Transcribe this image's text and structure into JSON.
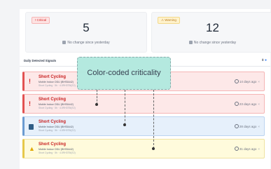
{
  "stats": [
    {
      "badge": "! Critical",
      "value": "5",
      "note": "No change since yesterday",
      "kind": "crit"
    },
    {
      "badge": "⚠ Warning",
      "value": "12",
      "note": "No change since yesterday",
      "kind": "warn"
    }
  ],
  "section": {
    "title": "Daily Detected Signals",
    "filter_icon": "filter-icon",
    "info_icon": "info-icon"
  },
  "signals": [
    {
      "severity": "critical",
      "icon": "alert-exclamation-icon",
      "title": "Short Cycling",
      "subtitle": "Mobile Indoor ODU (BHS5A42)",
      "meta": "Short Cycling · 5h · 4.0RH3T5I(E2)",
      "age": "14 days ago"
    },
    {
      "severity": "critical",
      "icon": "alert-exclamation-icon",
      "title": "Short Cycling",
      "subtitle": "Mobile Indoor ODU (BHS5A42)",
      "meta": "Short Cycling · 5h · 4.0RH3T5I(E2)",
      "age": "23 days ago"
    },
    {
      "severity": "info",
      "icon": "database-icon",
      "title": "Short Cycling",
      "subtitle": "Mobile Indoor ODU (BHS5A42)",
      "meta": "Short Cycling · 5h · 4.0RH3T5I(E2)",
      "age": "28 days ago"
    },
    {
      "severity": "warning",
      "icon": "warning-triangle-icon",
      "title": "Short Cycling",
      "subtitle": "Mobile Indoor ODU (BHS5A42)",
      "meta": "Short Cycling · 5h · 4.0RH3T5I(E2)",
      "age": "31 days ago"
    }
  ],
  "annotation": {
    "label": "Color-coded criticality"
  },
  "colors": {
    "critical": "#e25252",
    "info": "#6b9bd1",
    "warning": "#e6c84a",
    "callout": "#b2e8de"
  }
}
